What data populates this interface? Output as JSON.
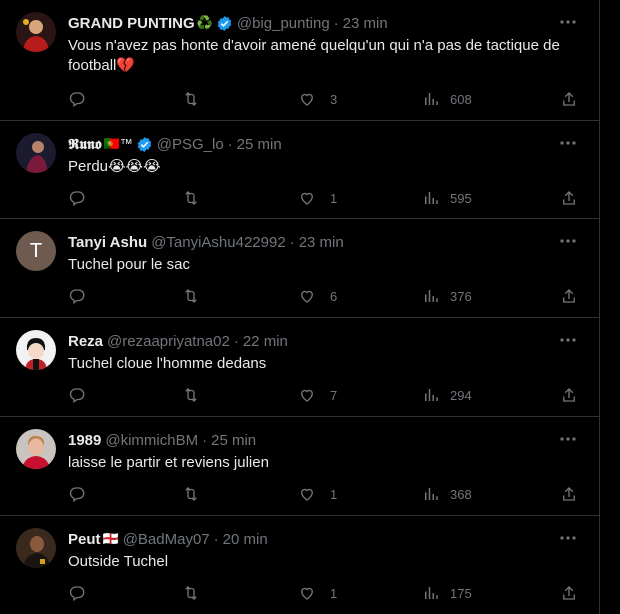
{
  "tweets": [
    {
      "name": "GRAND PUNTING",
      "badge": "♻️",
      "verified": true,
      "handle": "@big_punting",
      "time": "23 min",
      "text": "Vous n'avez pas honte d'avoir amené quelqu'un qui n'a pas de tactique de football💔",
      "likes": "3",
      "views": "608",
      "avatar_icon": "avatar-icon"
    },
    {
      "name": "𝕽𝖚𝖓𝖔",
      "badge": "🇵🇹™",
      "verified": true,
      "handle": "@PSG_lo",
      "time": "25 min",
      "text": "Perdu😭😭😭",
      "likes": "1",
      "views": "595",
      "avatar_icon": "avatar-icon"
    },
    {
      "name": "Tanyi Ashu",
      "badge": "",
      "verified": false,
      "handle": "@TanyiAshu422992",
      "time": "23 min",
      "text": "Tuchel pour le sac",
      "likes": "6",
      "views": "376",
      "avatar_letter": "T"
    },
    {
      "name": "Reza",
      "badge": "",
      "verified": false,
      "handle": "@rezaapriyatna02",
      "time": "22 min",
      "text": "Tuchel cloue l'homme dedans",
      "likes": "7",
      "views": "294",
      "avatar_icon": "avatar-icon"
    },
    {
      "name": "1989",
      "badge": "",
      "verified": false,
      "handle": "@kimmichBM",
      "time": "25 min",
      "text": "laisse le partir et reviens julien",
      "likes": "1",
      "views": "368",
      "avatar_icon": "avatar-icon"
    },
    {
      "name": "Peut",
      "badge": "🏴󠁧󠁢󠁥󠁮󠁧󠁿",
      "verified": false,
      "handle": "@BadMay07",
      "time": "20 min",
      "text": "Outside Tuchel",
      "likes": "1",
      "views": "175",
      "avatar_icon": "avatar-icon"
    }
  ],
  "colors": {
    "background": "#000000",
    "text": "#e7e9ea",
    "muted": "#71767b",
    "verified": "#1d9bf0",
    "divider": "#2f3336"
  },
  "icons": [
    "reply-icon",
    "retweet-icon",
    "like-icon",
    "views-icon",
    "share-icon",
    "more-icon",
    "verified-icon"
  ]
}
